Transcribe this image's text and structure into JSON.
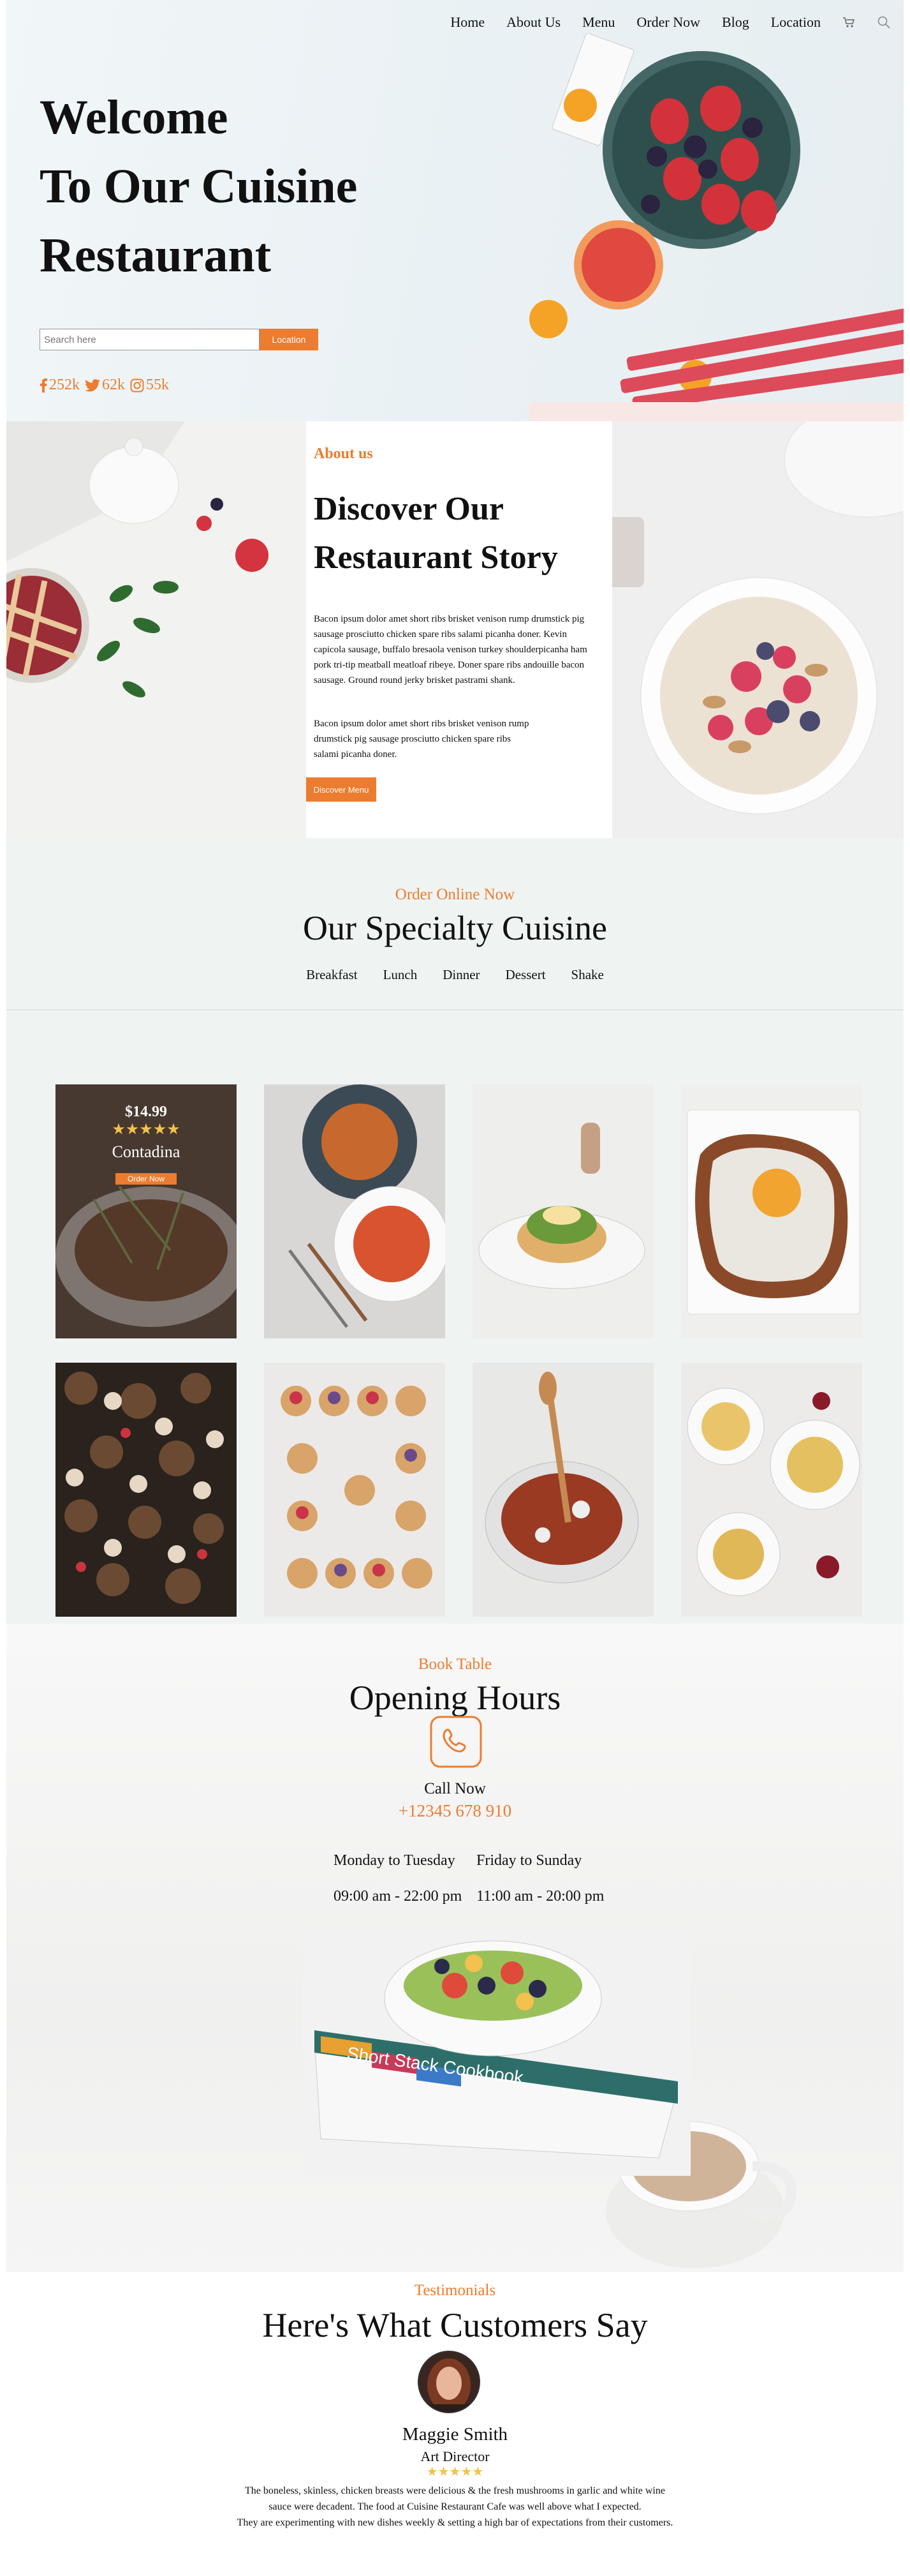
{
  "nav": {
    "items": [
      "Home",
      "About Us",
      "Menu",
      "Order Now",
      "Blog",
      "Location"
    ],
    "cart_icon": "cart-icon",
    "search_icon": "search-icon"
  },
  "hero": {
    "title_lines": [
      "Welcome",
      "To Our Cuisine",
      "Restaurant"
    ],
    "search_placeholder": "Search here",
    "location_button": "Location",
    "social": [
      {
        "icon": "facebook-icon",
        "count": "252k"
      },
      {
        "icon": "twitter-icon",
        "count": "62k"
      },
      {
        "icon": "instagram-icon",
        "count": "55k"
      }
    ]
  },
  "about": {
    "label": "About us",
    "title_lines": [
      "Discover Our",
      "Restaurant Story"
    ],
    "para1": "Bacon ipsum dolor amet short ribs brisket venison rump drumstick pig sausage prosciutto chicken spare ribs salami picanha doner. Kevin capicola sausage, buffalo bresaola venison turkey shoulderpicanha ham pork tri-tip meatball meatloaf ribeye. Doner spare ribs andouille bacon sausage. Ground round jerky brisket pastrami shank.",
    "para2": "Bacon ipsum dolor amet short ribs brisket venison rump drumstick pig sausage prosciutto chicken spare ribs salami picanha doner.",
    "button": "Discover Menu"
  },
  "specialty": {
    "label": "Order Online Now",
    "title": "Our Specialty Cuisine",
    "tabs": [
      "Breakfast",
      "Lunch",
      "Dinner",
      "Dessert",
      "Shake"
    ],
    "featured": {
      "price": "$14.99",
      "stars": "★★★★★",
      "name": "Contadina",
      "button": "Order Now"
    }
  },
  "hours": {
    "label": "Book Table",
    "title": "Opening Hours",
    "phone_icon": "phone-icon",
    "call_label": "Call Now",
    "phone": "+12345 678 910",
    "days": [
      "Monday to Tuesday",
      "Friday to Sunday"
    ],
    "times": [
      "09:00 am - 22:00 pm",
      "11:00 am - 20:00 pm"
    ],
    "book_title": "Short Stack Cookbook"
  },
  "testimonials": {
    "label": "Testimonials",
    "title": "Here's What Customers Say",
    "name": "Maggie Smith",
    "role": "Art Director",
    "stars": "★★★★★",
    "quote_lines": [
      "The boneless, skinless, chicken breasts were delicious & the fresh mushrooms in garlic and white wine",
      "sauce were decadent. The food at Cuisine Restaurant Cafe was well above what I expected.",
      "They are experimenting with new dishes weekly & setting a high bar of expectations from their customers."
    ]
  },
  "colors": {
    "accent": "#ec7c2f",
    "hero_bg": "#eef4f6",
    "section_bg": "#eff4f3"
  }
}
